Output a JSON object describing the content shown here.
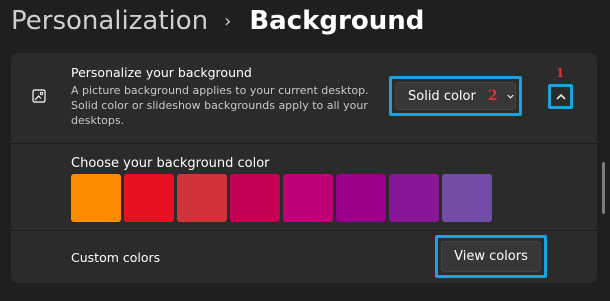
{
  "breadcrumb": {
    "parent": "Personalization",
    "separator": "›",
    "current": "Background"
  },
  "personalize": {
    "title": "Personalize your background",
    "description": "A picture background applies to your current desktop. Solid color or slideshow backgrounds apply to all your desktops.",
    "dropdown_value": "Solid color",
    "icon": "picture-icon"
  },
  "annotations": {
    "marker_1": "1",
    "marker_2": "2",
    "highlight_color": "#19a3e0",
    "marker_color": "#e4302e"
  },
  "color_picker": {
    "label": "Choose your background color",
    "swatches": [
      "#ff8c00",
      "#e81123",
      "#d13438",
      "#c30052",
      "#bf0077",
      "#9a0089",
      "#881798",
      "#744da9"
    ]
  },
  "custom_colors": {
    "label": "Custom colors",
    "button_label": "View colors"
  }
}
